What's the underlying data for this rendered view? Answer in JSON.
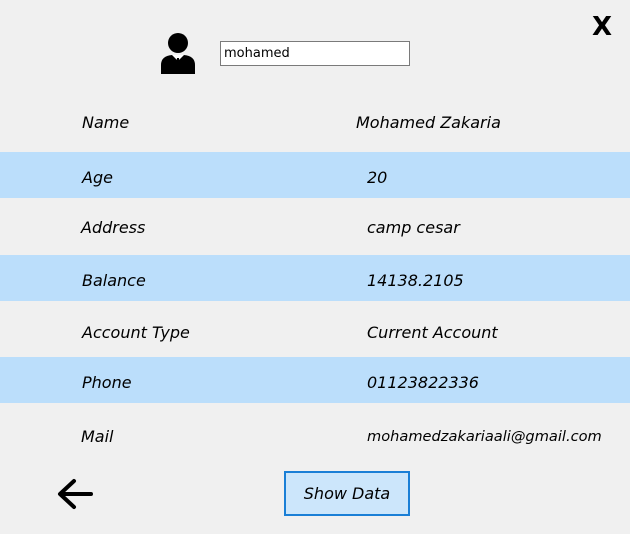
{
  "header": {
    "close_label": "X",
    "user_icon": "user-icon",
    "search": {
      "value": "mohamed"
    }
  },
  "details": {
    "rows": [
      {
        "label": "Name",
        "value": "Mohamed Zakaria",
        "highlighted": false
      },
      {
        "label": "Age",
        "value": "20",
        "highlighted": true
      },
      {
        "label": "Address",
        "value": "camp cesar",
        "highlighted": false
      },
      {
        "label": "Balance",
        "value": "14138.2105",
        "highlighted": true
      },
      {
        "label": "Account Type",
        "value": "Current Account",
        "highlighted": false
      },
      {
        "label": "Phone",
        "value": "01123822336",
        "highlighted": true
      },
      {
        "label": "Mail",
        "value": "mohamedzakariaali@gmail.com",
        "highlighted": false
      }
    ]
  },
  "footer": {
    "back_icon": "arrow-left-icon",
    "show_data_label": "Show Data"
  },
  "colors": {
    "background": "#f0f0f0",
    "row_highlight": "#bbdefb",
    "button_border": "#1a7fd6",
    "button_fill": "#cce6fb"
  }
}
